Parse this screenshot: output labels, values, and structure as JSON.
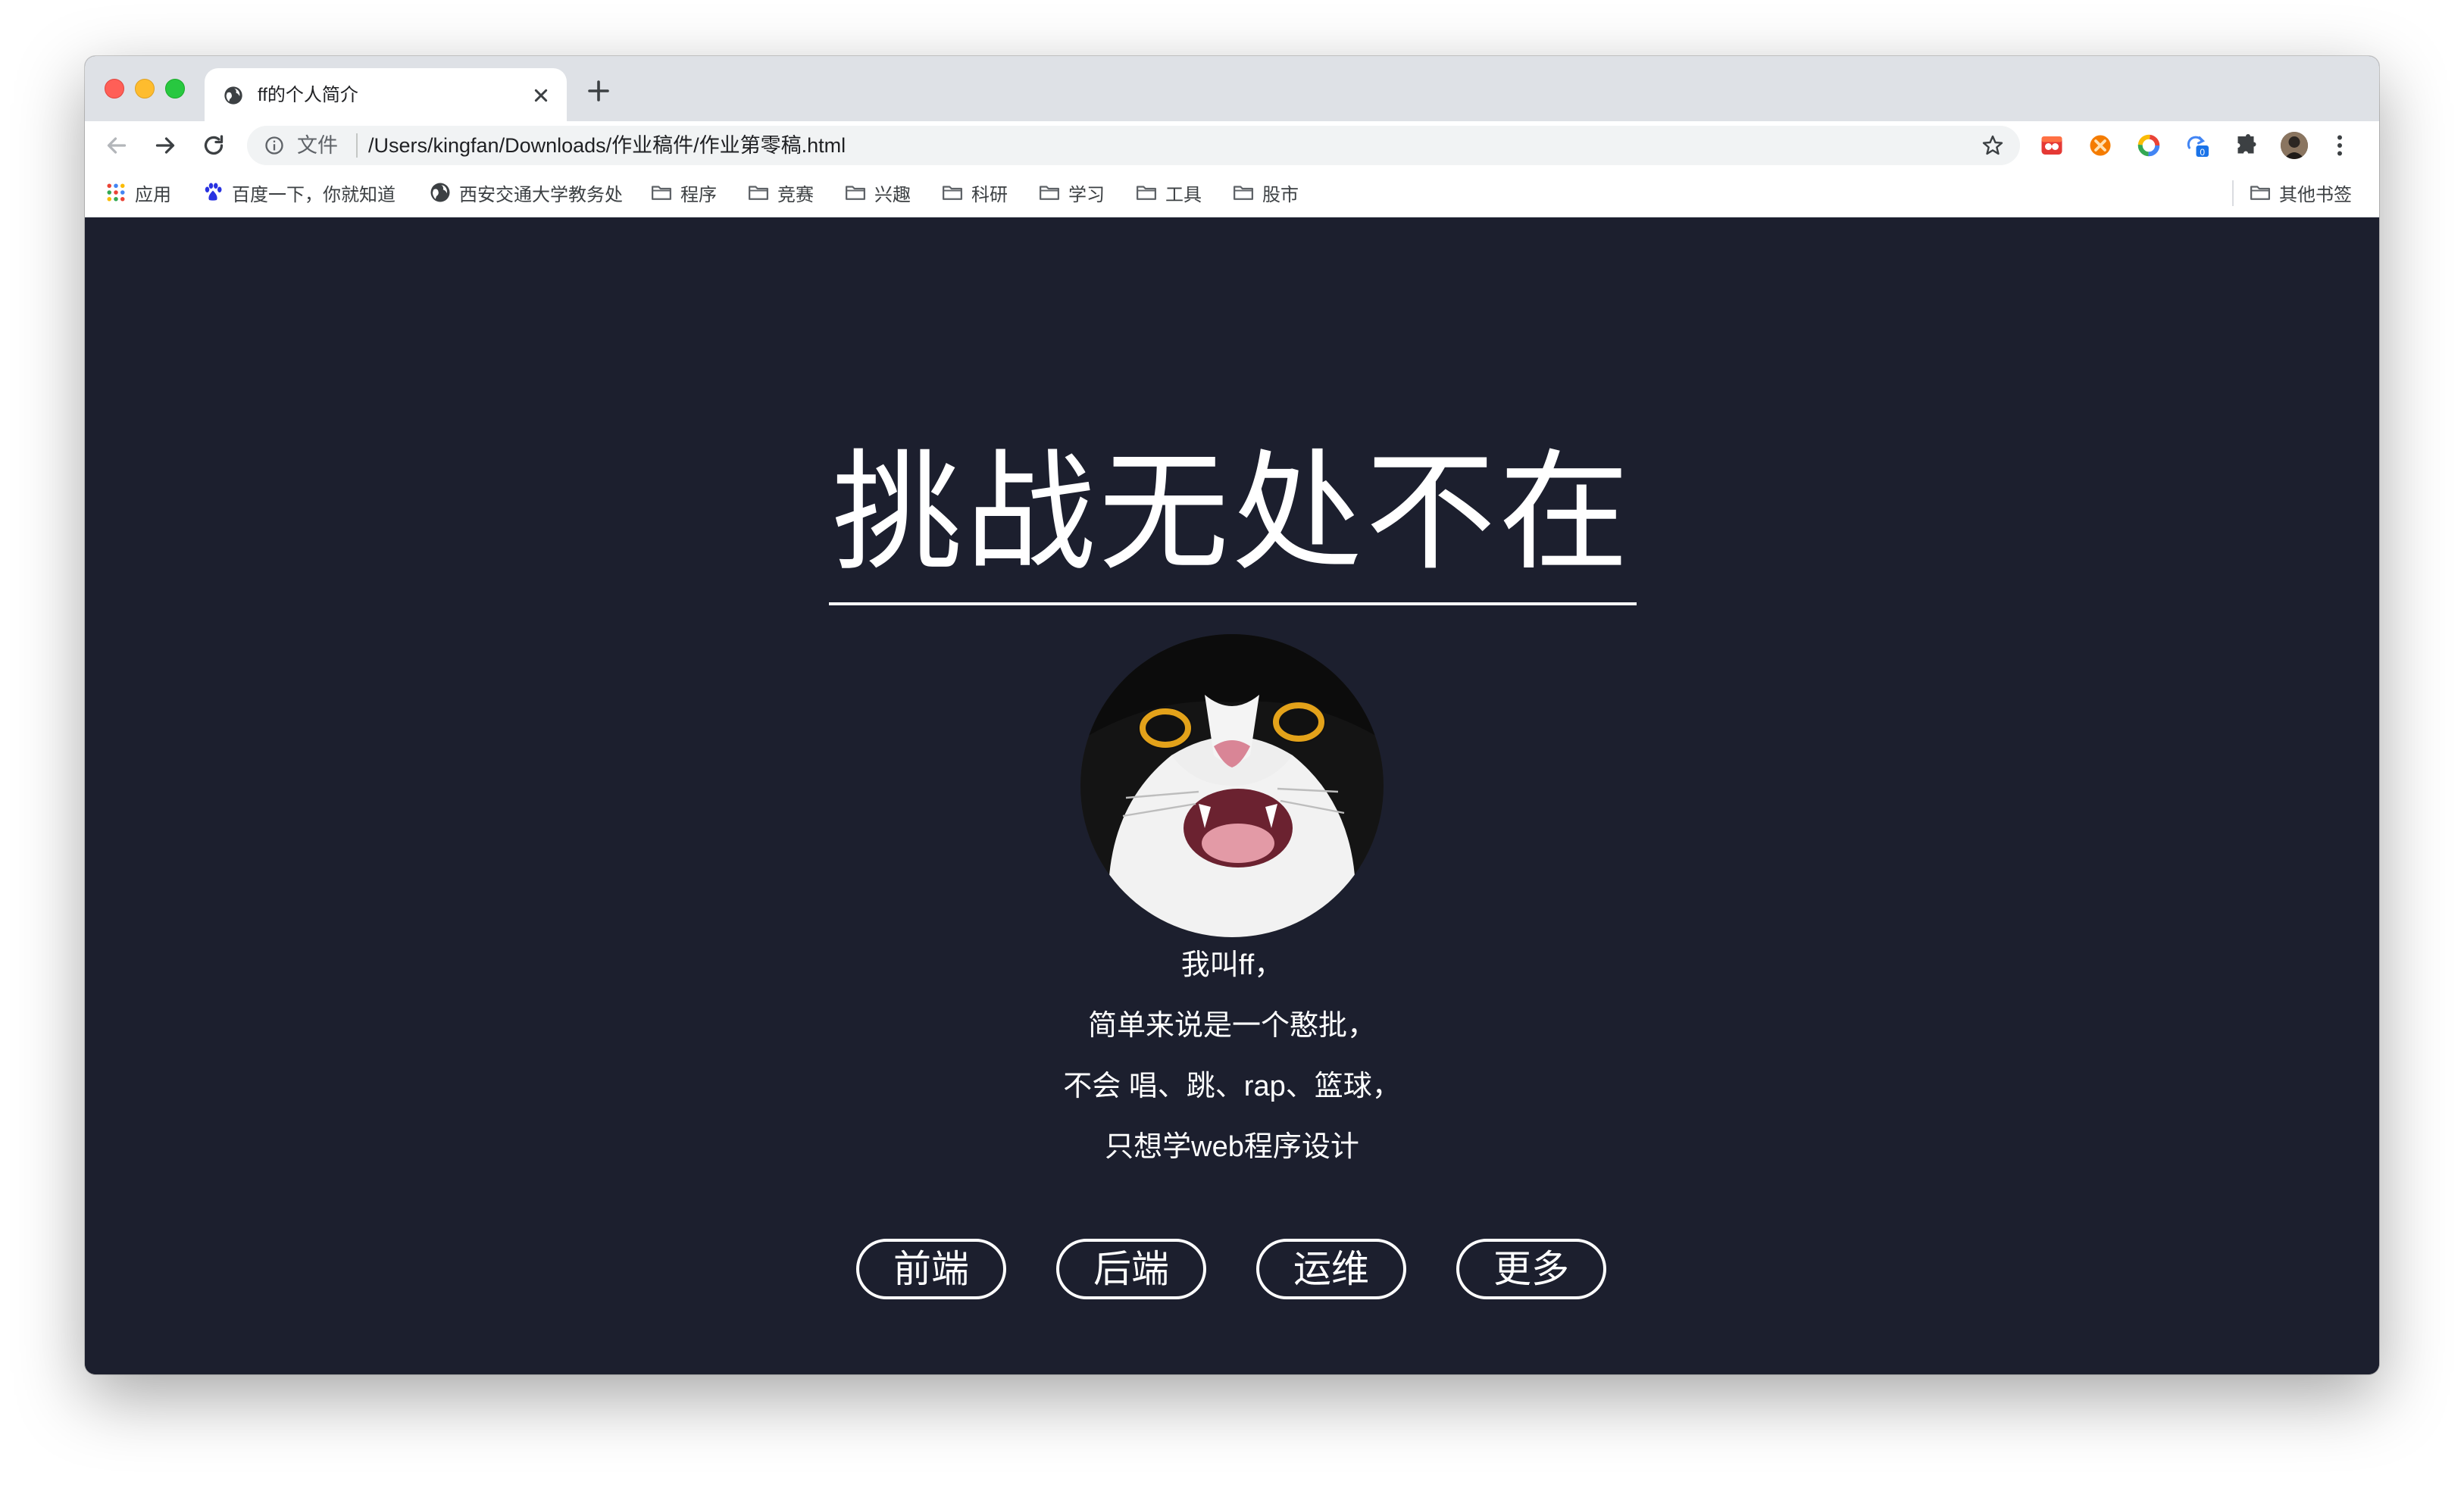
{
  "tab": {
    "title": "ff的个人简介",
    "icon": "globe-icon"
  },
  "toolbar": {
    "scheme_label": "文件",
    "url": "/Users/kingfan/Downloads/作业稿件/作业第零稿.html"
  },
  "bookmarks": {
    "items": [
      {
        "label": "应用",
        "icon": "apps-grid-icon"
      },
      {
        "label": "百度一下，你就知道",
        "icon": "baidu-paw-icon"
      },
      {
        "label": "西安交通大学教务处",
        "icon": "globe-icon"
      },
      {
        "label": "程序",
        "icon": "folder-icon"
      },
      {
        "label": "竞赛",
        "icon": "folder-icon"
      },
      {
        "label": "兴趣",
        "icon": "folder-icon"
      },
      {
        "label": "科研",
        "icon": "folder-icon"
      },
      {
        "label": "学习",
        "icon": "folder-icon"
      },
      {
        "label": "工具",
        "icon": "folder-icon"
      },
      {
        "label": "股市",
        "icon": "folder-icon"
      }
    ],
    "other_label": "其他书签"
  },
  "extensions": {
    "badge_count": "0"
  },
  "page": {
    "title": "挑战无处不在",
    "intro_lines": [
      "我叫ff，",
      "简单来说是一个憨批，",
      "不会 唱、跳、rap、篮球，",
      "只想学web程序设计"
    ],
    "tags": [
      "前端",
      "后端",
      "运维",
      "更多"
    ]
  },
  "colors": {
    "page_bg": "#1c1f2e",
    "text": "#ffffff",
    "tabstrip_bg": "#dee1e6"
  }
}
